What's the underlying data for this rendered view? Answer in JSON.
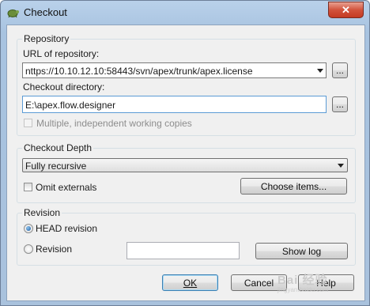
{
  "window": {
    "title": "Checkout",
    "close_label": "✕"
  },
  "repository": {
    "group_label": "Repository",
    "url_label": "URL of repository:",
    "url_value": "nttps://10.10.12.10:58443/svn/apex/trunk/apex.license",
    "dir_label": "Checkout directory:",
    "dir_value": "E:\\apex.flow.designer",
    "browse_label": "...",
    "multiple_label": "Multiple, independent working copies"
  },
  "depth": {
    "group_label": "Checkout Depth",
    "selected": "Fully recursive",
    "omit_label": "Omit externals",
    "choose_label": "Choose items..."
  },
  "revision": {
    "group_label": "Revision",
    "head_label": "HEAD revision",
    "rev_label": "Revision",
    "rev_value": "",
    "showlog_label": "Show log"
  },
  "buttons": {
    "ok": "OK",
    "cancel": "Cancel",
    "help": "Help"
  },
  "watermark": {
    "main": "Bai 经验",
    "sub": "jingyan.baidu.com"
  }
}
